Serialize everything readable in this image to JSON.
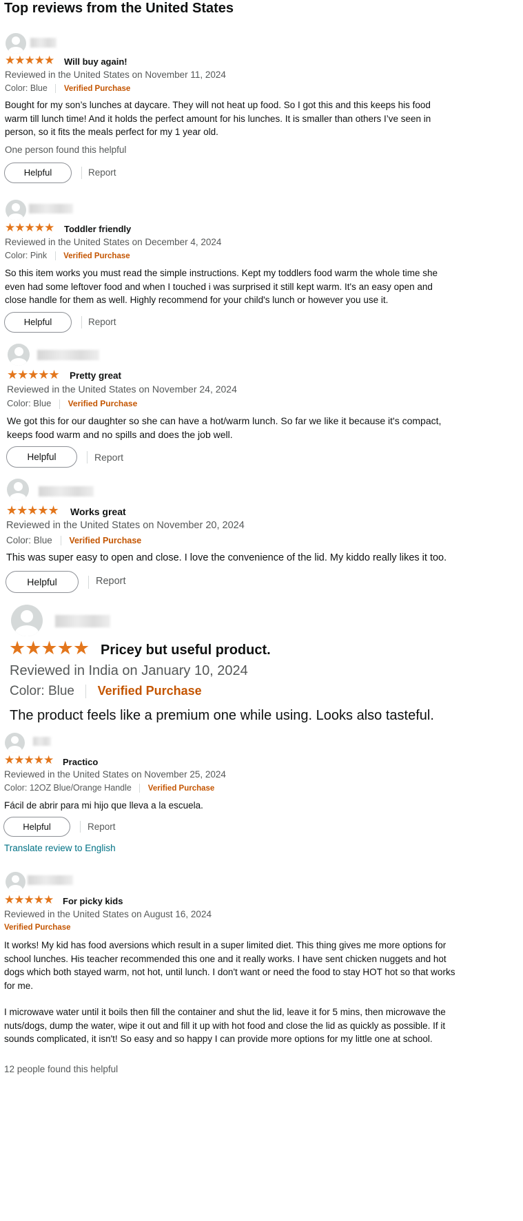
{
  "page_title": "Top reviews from the United States",
  "colors": {
    "star": "#e3761c",
    "verified": "#c45500",
    "link": "#007185",
    "muted": "#565959"
  },
  "icons": {
    "avatar": "user-avatar-icon",
    "star": "star-icon"
  },
  "stars_glyph": "★★★★★",
  "helpful_label": "Helpful",
  "report_label": "Report",
  "reviews": [
    {
      "rating": 5,
      "stars": "★★★★★",
      "title": "Will buy again!",
      "meta": "Reviewed in the United States on November 11, 2024",
      "color": "Color: Blue",
      "verified": "Verified Purchase",
      "body": "Bought for my son’s lunches at daycare. They will not heat up food. So I got this and this keeps his food warm till lunch time! And it holds the perfect amount for his lunches. It is smaller than others I’ve seen in person, so it fits the meals perfect for my 1 year old.",
      "found_helpful": "One person found this helpful"
    },
    {
      "rating": 5,
      "stars": "★★★★★",
      "title": "Toddler friendly",
      "meta": "Reviewed in the United States on December 4, 2024",
      "color": "Color: Pink",
      "verified": "Verified Purchase",
      "body": "So this item works you must read the simple instructions. Kept my toddlers food warm the whole time she even had some leftover food and when I touched i was surprised it still kept warm. It's an easy open and close handle for them as well. Highly recommend for your child's lunch or however you use it."
    },
    {
      "rating": 5,
      "stars": "★★★★★",
      "title": "Pretty great",
      "meta": "Reviewed in the United States on November 24, 2024",
      "color": "Color: Blue",
      "verified": "Verified Purchase",
      "body": "We got this for our daughter so she can have a hot/warm lunch. So far we like it because it's compact, keeps food warm and no spills and does the job well."
    },
    {
      "rating": 5,
      "stars": "★★★★★",
      "title": "Works great",
      "meta": "Reviewed in the United States on November 20, 2024",
      "color": "Color: Blue",
      "verified": "Verified Purchase",
      "body": "This was super easy to open and close. I love the convenience of the lid. My kiddo really likes it too."
    },
    {
      "rating": 5,
      "stars": "★★★★★",
      "title": "Pricey but useful product.",
      "meta": "Reviewed in India on January 10, 2024",
      "color": "Color: Blue",
      "verified": "Verified Purchase",
      "body": "The product feels like a premium one while using. Looks also tasteful."
    },
    {
      "rating": 5,
      "stars": "★★★★★",
      "title": "Practico",
      "meta": "Reviewed in the United States on November 25, 2024",
      "color": "Color: 12OZ Blue/Orange Handle",
      "verified": "Verified Purchase",
      "body": "Fácil de abrir para mi hijo que lleva a la escuela.",
      "translate": "Translate review to English"
    },
    {
      "rating": 5,
      "stars": "★★★★★",
      "title": "For picky kids",
      "meta": "Reviewed in the United States on August 16, 2024",
      "verified": "Verified Purchase",
      "body": "It works! My kid has food aversions which result in a super limited diet. This thing gives me more options for school lunches. His teacher recommended this one and it really works. I have sent chicken nuggets and hot dogs which both stayed warm, not hot, until lunch. I don't want or need the food to stay HOT hot so that works for me.",
      "body2": "I microwave water until it boils then fill the container and shut the lid, leave it for 5 mins, then microwave the nuts/dogs, dump the water, wipe it out and fill it up with hot food and close the lid as quickly as possible. If it sounds complicated, it isn't! So easy and so happy I can provide more options for my little one at school.",
      "found_helpful": "12 people found this helpful"
    }
  ]
}
